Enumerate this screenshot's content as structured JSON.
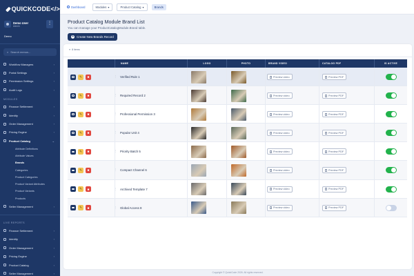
{
  "app": {
    "logo_text": "QUICKCODE</>"
  },
  "user": {
    "name": "Demo User",
    "role": "Admin",
    "menu_glyph": "⋮",
    "environment": "Demo"
  },
  "search": {
    "placeholder": "Search menus..."
  },
  "sidebar": {
    "top_items": [
      {
        "label": "Workflow Managers"
      },
      {
        "label": "Portal Settings"
      },
      {
        "label": "Permission Settings"
      },
      {
        "label": "Audit Logs"
      }
    ],
    "modules_label": "MODULES",
    "module_items": [
      {
        "label": "Finance Settlement"
      },
      {
        "label": "Identity"
      },
      {
        "label": "Order Management"
      },
      {
        "label": "Pricing Engine"
      },
      {
        "label": "Product Catalog"
      }
    ],
    "catalog_sub": [
      {
        "label": "Attribute Definitions"
      },
      {
        "label": "Attribute Values"
      },
      {
        "label": "Brands"
      },
      {
        "label": "Categories"
      },
      {
        "label": "Product Categories"
      },
      {
        "label": "Product Variant Attributes"
      },
      {
        "label": "Product Variants"
      },
      {
        "label": "Products"
      }
    ],
    "seller": {
      "label": "Seller Management"
    },
    "live_label": "LIVE REPORTS",
    "live_items": [
      {
        "label": "Finance Settlement"
      },
      {
        "label": "Identity"
      },
      {
        "label": "Order Management"
      },
      {
        "label": "Pricing Engine"
      },
      {
        "label": "Product Catalog"
      },
      {
        "label": "Seller Management"
      }
    ]
  },
  "breadcrumb": {
    "home": "Dashboard",
    "modules": "Modules",
    "catalog": "Product Catalog",
    "current": "Brands"
  },
  "page": {
    "title": "Product Catalog Module Brand List",
    "subtitle": "You can manage your ProductCatalogModule.Brand table.",
    "create_label": "Create New Brands Record",
    "items_label": "8 items"
  },
  "table": {
    "headers": {
      "name": "NAME",
      "logo": "LOGO",
      "photo": "PHOTO",
      "video": "BRAND VIDEO",
      "pdf": "CATALOG PDF",
      "active": "IS ACTIVE"
    },
    "video_btn": "Preview video",
    "pdf_btn": "Preview PDF",
    "rows": [
      {
        "name": "Verified Rule 1",
        "active": true,
        "logo": "#8a7a68",
        "photo": "#7a5a2a"
      },
      {
        "name": "Required Record 2",
        "active": true,
        "logo": "#4a3a32",
        "photo": "#3e6a4a"
      },
      {
        "name": "Professional Permission 3",
        "active": true,
        "logo": "#b07a3a",
        "photo": "#4a5a6a"
      },
      {
        "name": "Popular Unit 4",
        "active": true,
        "logo": "#2a2a2a",
        "photo": "#5a6a5a"
      },
      {
        "name": "Priority Batch 5",
        "active": true,
        "logo": "#8a6a4a",
        "photo": "#a05a2a"
      },
      {
        "name": "Compact Channel 6",
        "active": true,
        "logo": "#9aa6b4",
        "photo": "#c06a2a"
      },
      {
        "name": "Archived Template 7",
        "active": true,
        "logo": "#6a6a6a",
        "photo": "#3a4a5a"
      },
      {
        "name": "Global Access 8",
        "active": false,
        "logo": "#3a5a8a",
        "photo": "#8a7a5a"
      }
    ]
  },
  "footer": {
    "text": "Copyright © QuickCode 2026. All rights reserved."
  }
}
